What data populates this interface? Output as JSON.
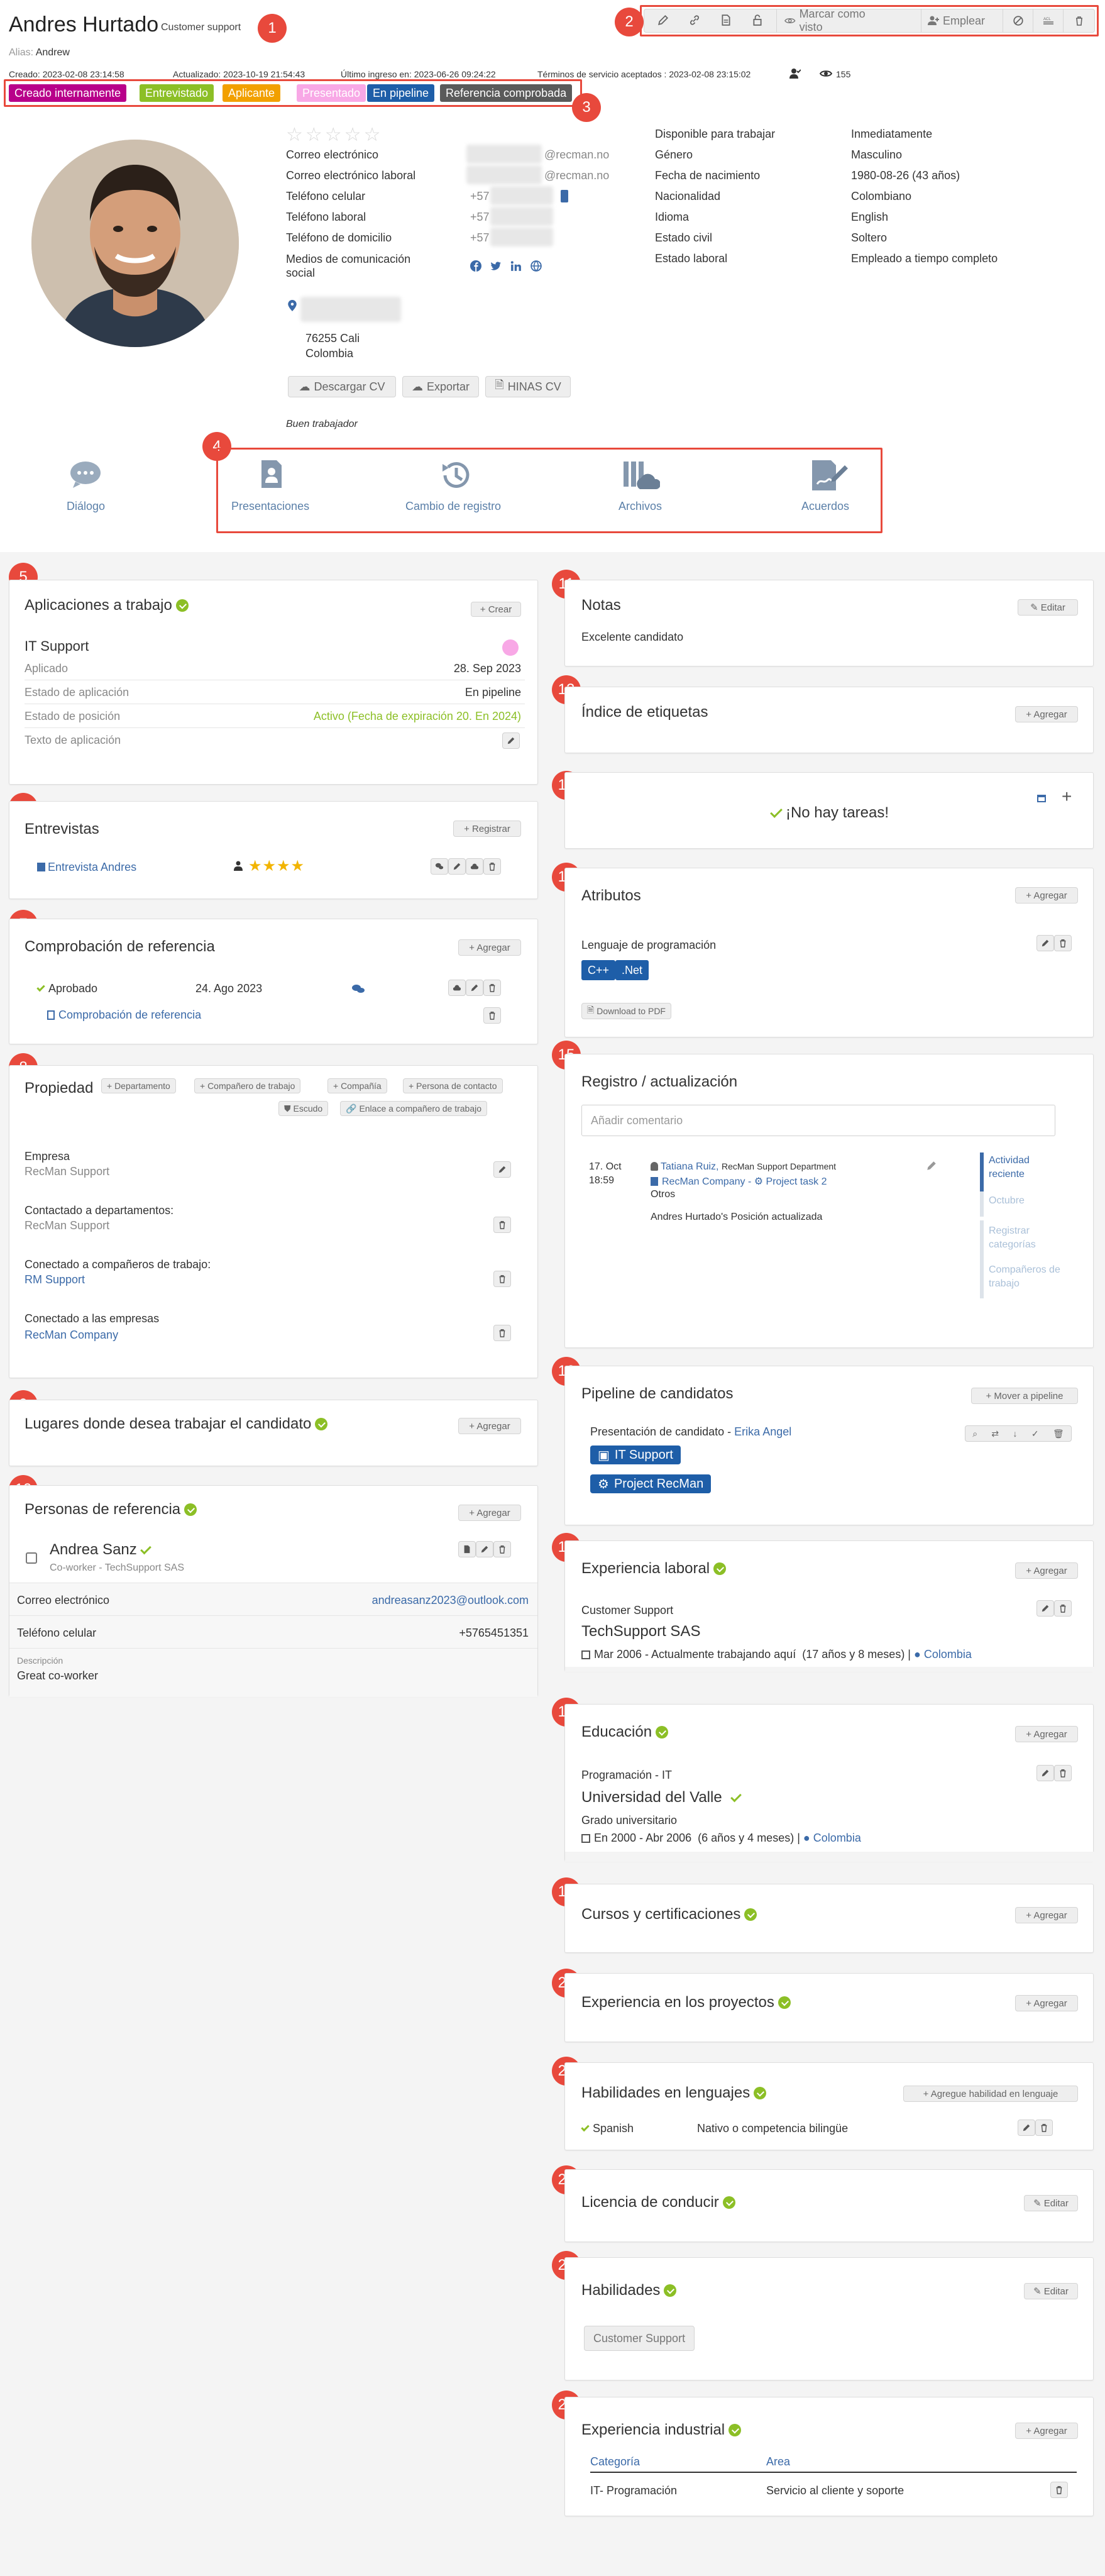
{
  "header": {
    "name": "Andres Hurtado",
    "role": "Customer support",
    "alias_label": "Alias:",
    "alias": "Andrew",
    "created": "Creado: 2023-02-08 23:14:58",
    "updated": "Actualizado: 2023-10-19 21:54:43",
    "last_login": "Último ingreso en: 2023-06-26 09:24:22",
    "terms": "Términos de servicio aceptados : 2023-02-08 23:15:02",
    "views": "155"
  },
  "toolbar": {
    "mark_seen": "Marcar como visto",
    "hire": "Emplear"
  },
  "tags": [
    {
      "label": "Creado internamente",
      "color": "#b8008a"
    },
    {
      "label": "Entrevistado",
      "color": "#8cbf26"
    },
    {
      "label": "Aplicante",
      "color": "#f2a000"
    },
    {
      "label": "Presentado",
      "color": "#f8a8e6"
    },
    {
      "label": "En pipeline",
      "color": "#1e5ea8"
    },
    {
      "label": "Referencia comprobada",
      "color": "#5a5a5a"
    }
  ],
  "contact": {
    "email_label": "Correo electrónico",
    "email_value": "@recman.no",
    "work_email_label": "Correo electrónico laboral",
    "work_email_value": "@recman.no",
    "mobile_label": "Teléfono celular",
    "mobile_value": "+57",
    "work_phone_label": "Teléfono laboral",
    "work_phone_value": "+57",
    "home_phone_label": "Teléfono de domicilio",
    "home_phone_value": "+57",
    "social_label": "Medios de comunicación social",
    "zip_city": "76255 Cali",
    "country": "Colombia",
    "download_cv": "Descargar CV",
    "export": "Exportar",
    "hinas_cv": "HINAS CV",
    "note": "Buen trabajador"
  },
  "details": {
    "available_label": "Disponible para trabajar",
    "available_value": "Inmediatamente",
    "gender_label": "Género",
    "gender_value": "Masculino",
    "birth_label": "Fecha de nacimiento",
    "birth_value": "1980-08-26 (43 años)",
    "nationality_label": "Nacionalidad",
    "nationality_value": "Colombiano",
    "language_label": "Idioma",
    "language_value": "English",
    "civil_label": "Estado civil",
    "civil_value": "Soltero",
    "employment_label": "Estado laboral",
    "employment_value": "Empleado a tiempo completo"
  },
  "nav": {
    "dialog": "Diálogo",
    "presentations": "Presentaciones",
    "log_change": "Cambio de registro",
    "files": "Archivos",
    "agreements": "Acuerdos"
  },
  "markers": [
    "1",
    "2",
    "3",
    "4",
    "5",
    "6",
    "7",
    "8",
    "9",
    "10",
    "11",
    "12",
    "13",
    "14",
    "15",
    "16",
    "17",
    "18",
    "19",
    "20",
    "21",
    "22",
    "23",
    "24"
  ],
  "common": {
    "create": "+ Crear",
    "register": "+ Registrar",
    "add": "+ Agregar",
    "edit": "Editar"
  },
  "applications": {
    "title": "Aplicaciones a trabajo",
    "job": "IT Support",
    "applied_label": "Aplicado",
    "applied_value": "28. Sep 2023",
    "app_state_label": "Estado de aplicación",
    "app_state_value": "En pipeline",
    "pos_state_label": "Estado de posición",
    "pos_state_value": "Activo (Fecha de expiración 20. En 2024)",
    "text_label": "Texto de aplicación"
  },
  "interviews": {
    "title": "Entrevistas",
    "item": "Entrevista Andres",
    "stars": "★★★★"
  },
  "reference_check": {
    "title": "Comprobación de referencia",
    "status": "Aprobado",
    "date": "24. Ago 2023",
    "link": "Comprobación de referencia"
  },
  "ownership": {
    "title": "Propiedad",
    "department": "+ Departamento",
    "coworker": "+ Compañero de trabajo",
    "company": "+ Compañía",
    "contact": "+ Persona de contacto",
    "shield": "Escudo",
    "link_coworker": "Enlace a compañero de trabajo",
    "company_label": "Empresa",
    "company_value": "RecMan Support",
    "dept_label": "Contactado a departamentos:",
    "dept_value": "RecMan Support",
    "cw_label": "Conectado a compañeros de trabajo:",
    "cw_value": "RM Support",
    "comp_label": "Conectado a las empresas",
    "comp_value": "RecMan Company"
  },
  "workplaces": {
    "title": "Lugares donde desea trabajar el candidato"
  },
  "references": {
    "title": "Personas de referencia",
    "name": "Andrea Sanz",
    "sub": "Co-worker - TechSupport SAS",
    "email_label": "Correo electrónico",
    "email_value": "andreasanz2023@outlook.com",
    "mobile_label": "Teléfono celular",
    "mobile_value": "+5765451351",
    "desc_label": "Descripción",
    "desc_value": "Great co-worker"
  },
  "notes": {
    "title": "Notas",
    "text": "Excelente candidato"
  },
  "tags_index": {
    "title": "Índice de etiquetas"
  },
  "tasks": {
    "text": "¡No hay tareas!"
  },
  "attributes": {
    "title": "Atributos",
    "group": "Lenguaje de programación",
    "items": [
      "C++",
      ".Net"
    ],
    "pdf": "Download to PDF"
  },
  "log": {
    "title": "Registro / actualización",
    "placeholder": "Añadir comentario",
    "date": "17. Oct",
    "time": "18:59",
    "user": "Tatiana Ruiz,",
    "dept": "RecMan Support Department",
    "company": "RecMan Company -",
    "project": "Project task 2",
    "other": "Otros",
    "text": "Andres Hurtado's Posición actualizada",
    "side": [
      "Actividad reciente",
      "Octubre",
      "Registrar categorías",
      "Compañeros de trabajo"
    ]
  },
  "pipeline": {
    "title": "Pipeline de candidatos",
    "move": "+ Mover a pipeline",
    "presentation": "Presentación de candidato -",
    "person": "Erika Angel",
    "badges": [
      "IT Support",
      "Project RecMan"
    ]
  },
  "experience": {
    "title": "Experiencia laboral",
    "role": "Customer Support",
    "company": "TechSupport SAS",
    "period": "Mar 2006 - Actualmente trabajando aquí",
    "duration": "(17 años y 8 meses) |",
    "location": "Colombia"
  },
  "education": {
    "title": "Educación",
    "field": "Programación - IT",
    "school": "Universidad del Valle",
    "degree": "Grado universitario",
    "period": "En 2000 - Abr 2006",
    "duration": "(6 años y 4 meses) |",
    "location": "Colombia"
  },
  "courses": {
    "title": "Cursos y certificaciones"
  },
  "projects": {
    "title": "Experiencia en los proyectos"
  },
  "languages": {
    "title": "Habilidades en lenguajes",
    "add": "+ Agregue habilidad en lenguaje",
    "lang": "Spanish",
    "level": "Nativo o competencia bilingüe"
  },
  "license": {
    "title": "Licencia de conducir"
  },
  "skills": {
    "title": "Habilidades",
    "item": "Customer Support"
  },
  "industry": {
    "title": "Experiencia industrial",
    "col1": "Categoría",
    "col2": "Area",
    "cat": "IT- Programación",
    "area": "Servicio al cliente y soporte"
  }
}
